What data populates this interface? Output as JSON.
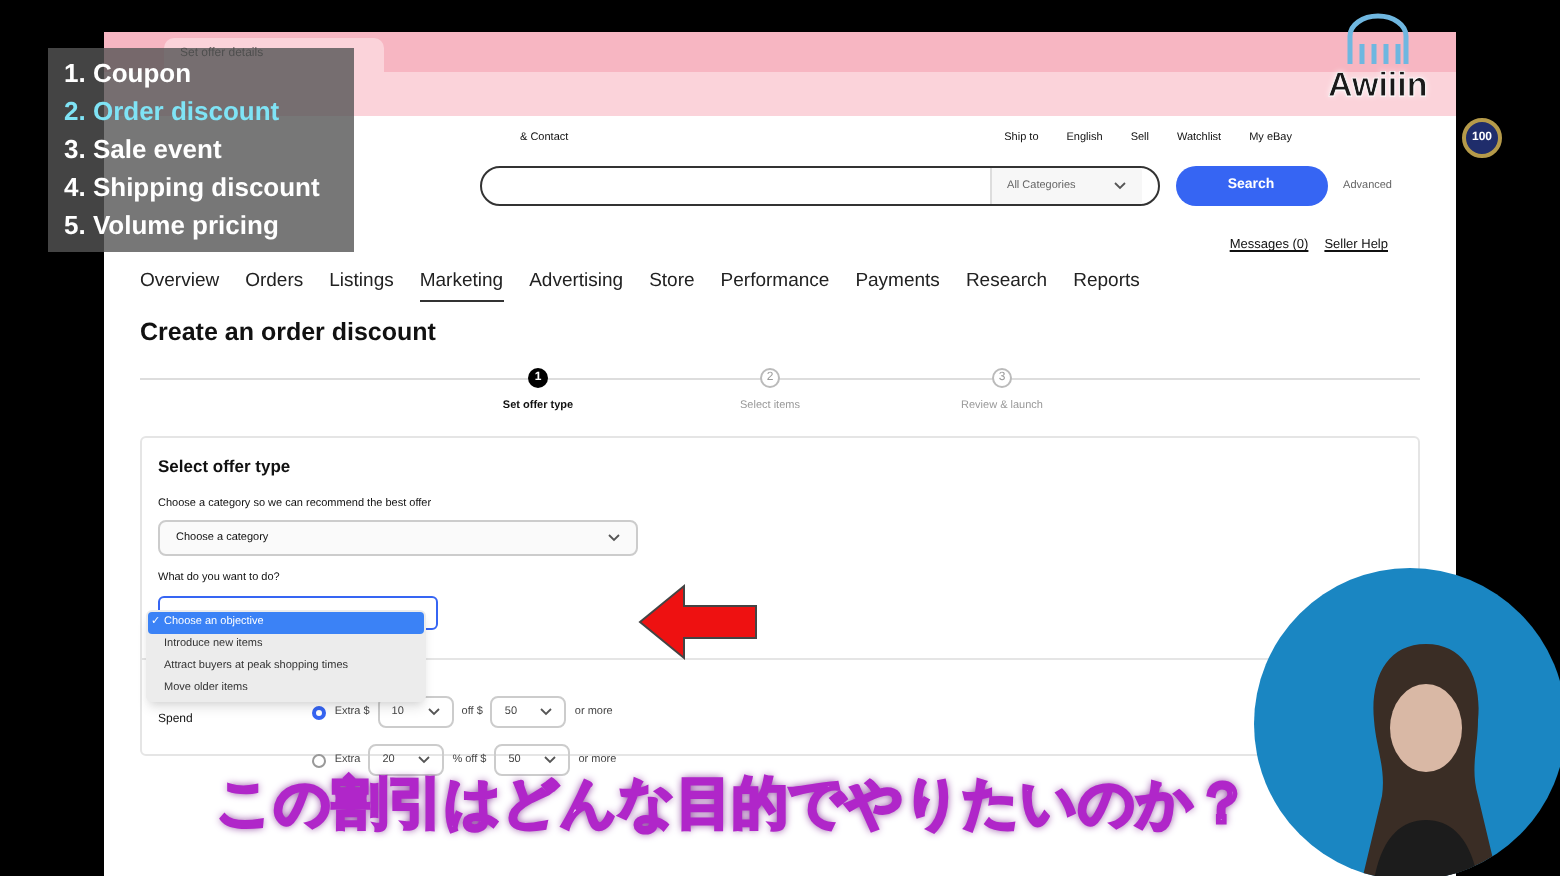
{
  "overlay_list": [
    {
      "text": "1. Coupon",
      "selected": false
    },
    {
      "text": "2. Order discount",
      "selected": true
    },
    {
      "text": "3. Sale event",
      "selected": false
    },
    {
      "text": "4. Shipping discount",
      "selected": false
    },
    {
      "text": "5. Volume pricing",
      "selected": false
    }
  ],
  "browser": {
    "tab_title": "Set offer details"
  },
  "header": {
    "contact": "& Contact",
    "links": [
      "Ship to",
      "English",
      "Sell",
      "Watchlist",
      "My eBay"
    ]
  },
  "search": {
    "category": "All Categories",
    "button": "Search",
    "advanced": "Advanced"
  },
  "seller_links": [
    "Messages (0)",
    "Seller Help"
  ],
  "nav": [
    {
      "label": "Overview",
      "selected": false
    },
    {
      "label": "Orders",
      "selected": false
    },
    {
      "label": "Listings",
      "selected": false
    },
    {
      "label": "Marketing",
      "selected": true
    },
    {
      "label": "Advertising",
      "selected": false
    },
    {
      "label": "Store",
      "selected": false
    },
    {
      "label": "Performance",
      "selected": false
    },
    {
      "label": "Payments",
      "selected": false
    },
    {
      "label": "Research",
      "selected": false
    },
    {
      "label": "Reports",
      "selected": false
    }
  ],
  "title": "Create an order discount",
  "steps": [
    {
      "number": "1",
      "label": "Set offer type",
      "selected": true
    },
    {
      "number": "2",
      "label": "Select items",
      "selected": false
    },
    {
      "number": "3",
      "label": "Review & launch",
      "selected": false
    }
  ],
  "card": {
    "check": "✓",
    "title": "Select offer type",
    "description": "Choose a category so we can recommend the best offer",
    "category_select": "Choose a category",
    "question": "What do you want to do?",
    "objective_options": [
      {
        "label": "Choose an objective",
        "selected": true
      },
      {
        "label": "Introduce new items",
        "selected": false
      },
      {
        "label": "Attract buyers at peak shopping times",
        "selected": false
      },
      {
        "label": "Move older items",
        "selected": false
      }
    ]
  },
  "spend": {
    "label": "Spend",
    "rows": [
      {
        "selected": true,
        "parts": [
          {
            "kind": "text",
            "text": "Extra $"
          },
          {
            "kind": "select",
            "text": "10"
          },
          {
            "kind": "text",
            "text": "off $"
          },
          {
            "kind": "select",
            "text": "50"
          },
          {
            "kind": "text",
            "text": "or more"
          }
        ]
      },
      {
        "selected": false,
        "parts": [
          {
            "kind": "text",
            "text": "Extra"
          },
          {
            "kind": "select",
            "text": "20"
          },
          {
            "kind": "text",
            "text": "% off $"
          },
          {
            "kind": "select",
            "text": "50"
          },
          {
            "kind": "text",
            "text": "or more"
          }
        ]
      }
    ]
  },
  "subtitle": "この割引はどんな目的でやりたいのか？",
  "logo": {
    "text": "Awiiin"
  },
  "badge": "100"
}
